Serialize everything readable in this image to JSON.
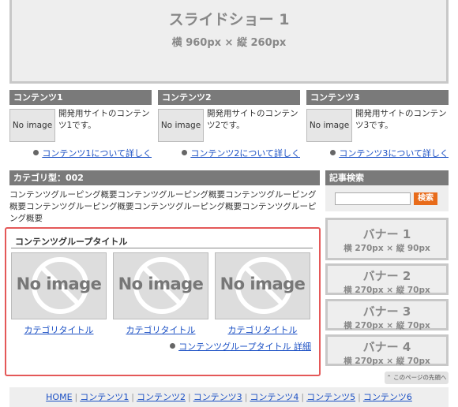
{
  "slideshow": {
    "title": "スライドショー 1",
    "size": "横 960px × 縦 260px"
  },
  "contents": [
    {
      "heading": "コンテンツ1",
      "thumb": "No image",
      "text": "開発用サイトのコンテンツ1です。",
      "link": "コンテンツ1について詳しく"
    },
    {
      "heading": "コンテンツ2",
      "thumb": "No image",
      "text": "開発用サイトのコンテンツ2です。",
      "link": "コンテンツ2について詳しく"
    },
    {
      "heading": "コンテンツ3",
      "thumb": "No image",
      "text": "開発用サイトのコンテンツ3です。",
      "link": "コンテンツ3について詳しく"
    }
  ],
  "category": {
    "heading": "カテゴリ型：002",
    "description": "コンテンツグルーピング概要コンテンツグルーピング概要コンテンツグルーピング概要コンテンツグルーピング概要コンテンツグルーピング概要コンテンツグルーピング概要"
  },
  "group": {
    "title": "コンテンツグループタイトル",
    "items": [
      {
        "thumb": "No image",
        "label": "カテゴリタイトル"
      },
      {
        "thumb": "No image",
        "label": "カテゴリタイトル"
      },
      {
        "thumb": "No image",
        "label": "カテゴリタイトル"
      }
    ],
    "more_link": "コンテンツグループタイトル 詳細"
  },
  "search": {
    "heading": "記事検索",
    "placeholder": "",
    "button": "検索"
  },
  "banners": [
    {
      "title": "バナー 1",
      "size": "横 270px × 縦 90px"
    },
    {
      "title": "バナー 2",
      "size": "横 270px × 縦 70px"
    },
    {
      "title": "バナー 3",
      "size": "横 270px × 縦 70px"
    },
    {
      "title": "バナー 4",
      "size": "横 270px × 縦 70px"
    }
  ],
  "page_top": "⌃ このページの先頭へ",
  "footer_nav": [
    "HOME",
    "コンテンツ1",
    "コンテンツ2",
    "コンテンツ3",
    "コンテンツ4",
    "コンテンツ5",
    "コンテンツ6"
  ],
  "colors": {
    "heading_bg": "#7a7a7a",
    "link": "#1a4fc4",
    "search_button": "#e86b1a",
    "group_border": "#e45858"
  }
}
